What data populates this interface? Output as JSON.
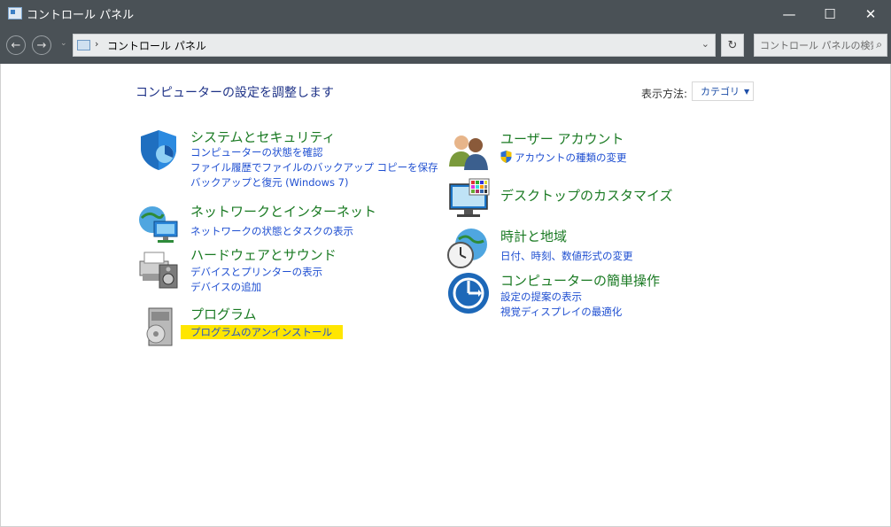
{
  "window": {
    "title": "コントロール パネル",
    "controls": {
      "minimize": "—",
      "maximize": "☐",
      "close": "✕"
    }
  },
  "toolbar": {
    "back": "←",
    "forward": "→",
    "recent": "⌄",
    "breadcrumb_sep": "›",
    "address_path": "コントロール パネル",
    "address_dropdown": "⌄",
    "refresh": "↻",
    "search_placeholder": "コントロール パネルの検索",
    "search_glyph": "⌕"
  },
  "main": {
    "heading": "コンピューターの設定を調整します",
    "view_by_label": "表示方法:",
    "view_by_value": "カテゴリ",
    "view_by_caret": "▼"
  },
  "categories": {
    "system": {
      "title": "システムとセキュリティ",
      "links": [
        "コンピューターの状態を確認",
        "ファイル履歴でファイルのバックアップ コピーを保存",
        "バックアップと復元 (Windows 7)"
      ]
    },
    "network": {
      "title": "ネットワークとインターネット",
      "links": [
        "ネットワークの状態とタスクの表示"
      ]
    },
    "hardware": {
      "title": "ハードウェアとサウンド",
      "links": [
        "デバイスとプリンターの表示",
        "デバイスの追加"
      ]
    },
    "programs": {
      "title": "プログラム",
      "links": [
        "プログラムのアンインストール"
      ]
    },
    "users": {
      "title": "ユーザー アカウント",
      "links": [
        "アカウントの種類の変更"
      ]
    },
    "appearance": {
      "title": "デスクトップのカスタマイズ",
      "links": []
    },
    "clock": {
      "title": "時計と地域",
      "links": [
        "日付、時刻、数値形式の変更"
      ]
    },
    "ease": {
      "title": "コンピューターの簡単操作",
      "links": [
        "設定の提案の表示",
        "視覚ディスプレイの最適化"
      ]
    }
  },
  "colors": {
    "titlebar": "#4a5156",
    "heading": "#1e3287",
    "category_title": "#1a7a23",
    "link": "#1f4fd1",
    "highlight": "#ffe600"
  }
}
